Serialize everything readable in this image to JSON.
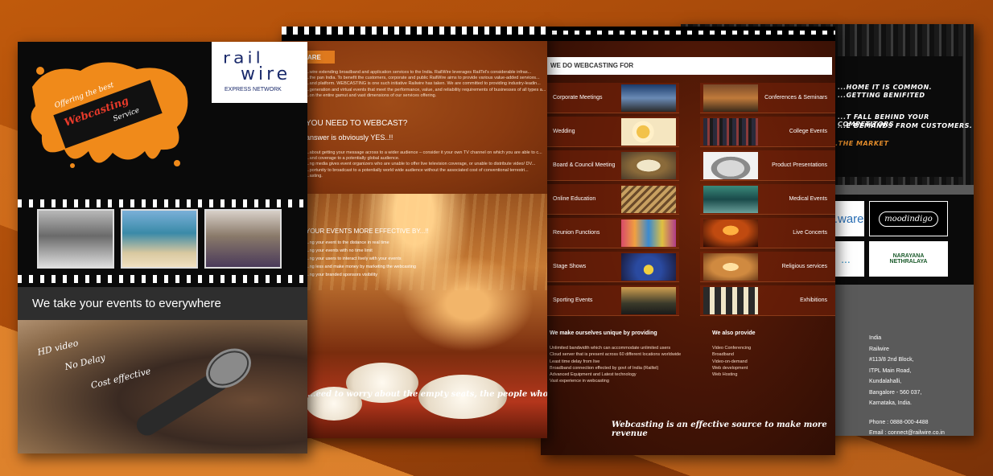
{
  "page4": {
    "grunge_lines": [
      "...HOME IT IS COMMON.",
      "...GETTING BENIFITED",
      "...T FALL BEHIND YOUR COMPETITORS",
      "...E DEMANDS FROM CUSTOMERS.",
      "...THE MARKET"
    ],
    "partner_logos": [
      "...ware",
      "moodindigo",
      "...",
      "NARAYANA NETHRALAYA"
    ],
    "address": [
      "India",
      "Railwire",
      "#113/8 2nd Block,",
      "ITPL Main Road,",
      "Kundalahalli,",
      "Bangalore - 560 037,",
      "Karnataka, India.",
      "",
      "Phone : 0888-000-4488",
      "Email : connect@railwire.co.in"
    ]
  },
  "page3": {
    "header": "WE DO WEBCASTING FOR",
    "left_items": [
      "Corporate Meetings",
      "Wedding",
      "Board & Council Meeting",
      "Online Education",
      "Reunion Functions",
      "Stage Shows",
      "Sporting Events"
    ],
    "right_items": [
      "Conferences & Seminars",
      "College Events",
      "Product Presentations",
      "Medical Events",
      "Live Concerts",
      "Religious services",
      "Exhibitions"
    ],
    "unique_title": "We make ourselves unique by providing",
    "unique_list": [
      "Unlimited bandwidth which can accommodate unlimited users",
      "Cloud server that is present across 60 different locations worldwide",
      "Least time delay from live",
      "Broadband connection effected by govt of India (Railtel)",
      "Advanced Equipment and Latest technology",
      "Vast experience in webcasting"
    ],
    "also_title": "We also provide",
    "also_list": [
      "Video Conferencing",
      "Broadband",
      "Video-on-demand",
      "Web development",
      "Web Hosting"
    ],
    "tagline": "Webcasting is an effective source to make more revenue"
  },
  "page2": {
    "we_are": "ARE",
    "intro": [
      "...wire extending broadband and application services to the India. RailWire leverages RailTel's considerable infras...",
      "...the pan India. To benefit the customers, corporate and public RailWire aims to provide various value-added services...",
      "...and platform. WEBCASTING is one such initiative Railwire has taken. We are committed to providing industry-leadin...",
      "...generation and virtual events that meet the performance, value, and reliability requirements of businesses of all types a...",
      "...on the entire gamut and vast dimensions of our services offering."
    ],
    "need_heading": "YOU NEED TO WEBCAST?",
    "answer": "answer is obviously YES..!!",
    "need_body": [
      "...about getting your message across to a wider audience – consider it your own TV channel on which you are able to c...",
      "...and coverage to a potentially global audience.",
      "...ng media gives event organizers who are unable to offer live television coverage, or unable to distribute video/ DV...",
      "...portunity to broadcast to a potentially world wide audience without the associated cost of conventional terrestri...",
      "...asting."
    ],
    "effective_heading": "YOUR EVENTS MORE EFFECTIVE BY...!!",
    "effective_list": [
      "...ng your event to the distance in real time",
      "...ng your events with no time limit",
      "...ng your users to interact lively with your events",
      "...ng less and make money by marketing the webcasting",
      "...ng your branded sponsors visibility"
    ],
    "tagline": "...eed to worry about the empty seats, the people who matters are w..."
  },
  "page1": {
    "splash_lines": [
      "Offering the best",
      "Webcasting",
      "Service"
    ],
    "logo_top": "rail",
    "logo_bottom": "wire",
    "logo_sub": "EXPRESS NETWORK",
    "band": "We take your events to everywhere",
    "handwritten": [
      "HD video",
      "No Delay",
      "Cost effective"
    ]
  }
}
